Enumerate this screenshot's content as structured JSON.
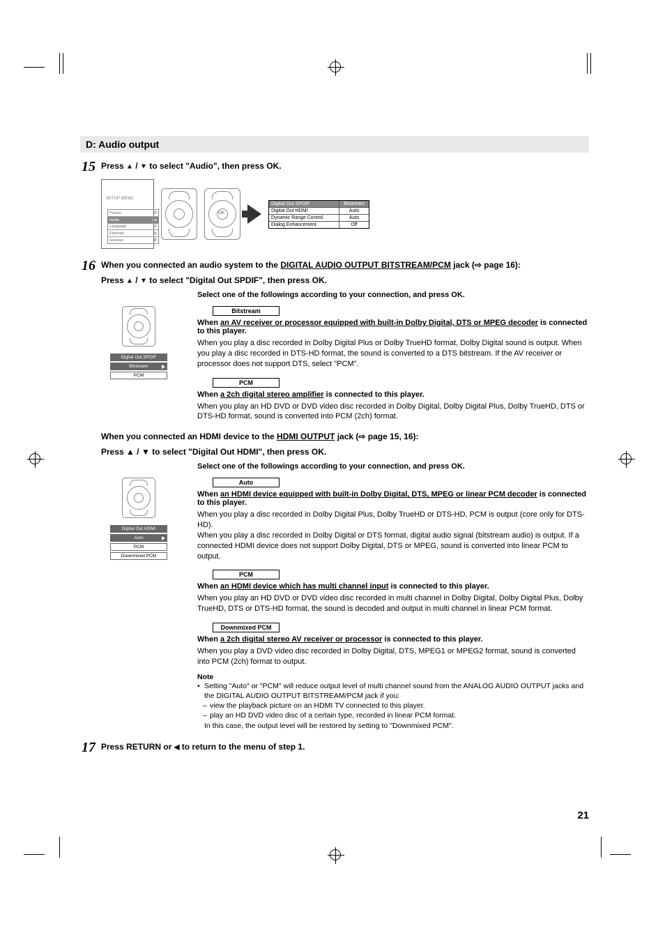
{
  "section_title": "D: Audio output",
  "steps": {
    "15": {
      "num": "15",
      "title_pre": "Press ",
      "title_mid": " to select \"Audio\", then press OK.",
      "setup_label": "SETUP MENU",
      "menu_items": [
        "Picture",
        "Audio",
        "Language",
        "Ethernet",
        "General"
      ],
      "settings": [
        {
          "label": "Digital Out SPDIF",
          "value": "Bitstream"
        },
        {
          "label": "Digital Out HDMI",
          "value": "Auto"
        },
        {
          "label": "Dynamic Range Control",
          "value": "Auto"
        },
        {
          "label": "Dialog Enhancement",
          "value": "Off"
        }
      ]
    },
    "16": {
      "num": "16",
      "line1_pre": "When you connected an audio system to the ",
      "line1_link": "DIGITAL AUDIO OUTPUT BITSTREAM/PCM",
      "line1_post": " jack (",
      "line1_page": " page 16):",
      "line2_pre": "Press ",
      "line2_mid": " to select \"Digital Out SPDIF\", then press OK.",
      "select_prompt": "Select one of the followings according to your connection, and press OK.",
      "spdif": {
        "osd_title": "Digital Out SPDIF",
        "osd_items": [
          "Bitstream",
          "PCM"
        ],
        "bitstream": {
          "label": "Bitstream",
          "when_pre": "When ",
          "when_u": "an AV receiver or processor equipped with built-in Dolby Digital, DTS or MPEG decoder",
          "when_post": " is connected to this player.",
          "desc": "When you play a disc recorded in Dolby Digital Plus or Dolby TrueHD format, Dolby Digital sound is output. When you play a disc recorded in DTS-HD format, the sound is converted to a DTS bitstream. If the AV receiver or processor does not support DTS, select \"PCM\"."
        },
        "pcm": {
          "label": "PCM",
          "when_pre": "When ",
          "when_u": "a 2ch digital stereo amplifier",
          "when_post": " is connected to this player.",
          "desc": "When you play an HD DVD or DVD video disc recorded in Dolby Digital, Dolby Digital Plus, Dolby TrueHD, DTS or DTS-HD format, sound is converted into PCM (2ch) format."
        }
      },
      "hdmi_heading_pre": "When you connected an HDMI device to the ",
      "hdmi_heading_link": "HDMI OUTPUT",
      "hdmi_heading_post": " jack (",
      "hdmi_heading_page": " page 15, 16):",
      "hdmi_line2_pre": "Press ",
      "hdmi_line2_mid": " to select \"Digital Out HDMI\", then press OK.",
      "hdmi": {
        "osd_title": "Digital Out HDMI",
        "osd_items": [
          "Auto",
          "PCM",
          "Downmixed PCM"
        ],
        "auto": {
          "label": "Auto",
          "when_pre": "When ",
          "when_u": "an HDMI device equipped with built-in Dolby Digital, DTS, MPEG or linear PCM decoder",
          "when_post": " is connected to this player.",
          "desc": "When you play a disc recorded in Dolby Digital Plus, Dolby TrueHD or DTS-HD, PCM is output (core only for DTS-HD).\nWhen you play a disc recorded in Dolby Digital or DTS format, digital audio signal (bitstream audio) is output. If a connected HDMI device does not support Dolby Digital, DTS or MPEG, sound is converted into linear PCM to output."
        },
        "pcm": {
          "label": "PCM",
          "when_pre": "When ",
          "when_u": "an HDMI device which has multi channel input",
          "when_post": " is connected to this player.",
          "desc": "When you play an HD DVD or DVD video disc recorded in multi channel in Dolby Digital, Dolby Digital Plus, Dolby TrueHD, DTS or DTS-HD format, the sound is decoded and output in multi channel in linear PCM format."
        },
        "downmixed": {
          "label": "Downmixed PCM",
          "when_pre": "When ",
          "when_u": "a 2ch digital stereo AV receiver or processor",
          "when_post": " is connected to this player.",
          "desc": "When you play a DVD video disc recorded in Dolby Digital, DTS, MPEG1 or MPEG2 format, sound is converted into PCM (2ch) format to output."
        }
      },
      "note": {
        "title": "Note",
        "b1": "Setting \"Auto\" or \"PCM\" will reduce output level of multi channel sound from the ANALOG AUDIO OUTPUT jacks and the DIGITAL AUDIO OUTPUT BITSTREAM/PCM jack if you:",
        "d1": "view the playback picture on an HDMI TV connected to this player.",
        "d2": "play an HD DVD video disc of a certain type, recorded in linear PCM format.",
        "b2": "In this case, the output level will be restored by setting to \"Downmixed PCM\"."
      }
    },
    "17": {
      "num": "17",
      "title_pre": "Press RETURN or ",
      "title_post": " to return to the menu of step 1."
    }
  },
  "page_number": "21",
  "glyphs": {
    "up": "▲",
    "down": "▼",
    "left": "◀",
    "slash": " / ",
    "pointer": "⇨"
  }
}
